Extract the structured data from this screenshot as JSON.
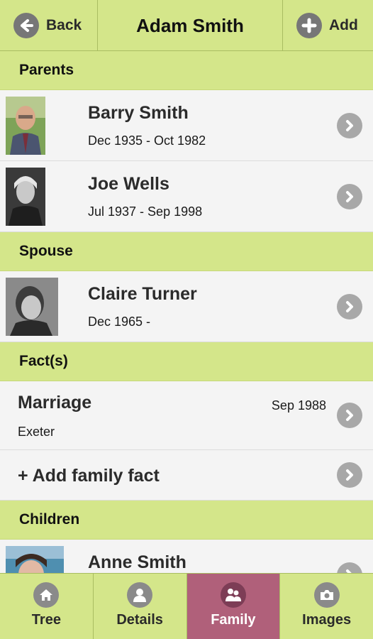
{
  "header": {
    "back_label": "Back",
    "title": "Adam Smith",
    "add_label": "Add"
  },
  "sections": {
    "parents": "Parents",
    "spouse": "Spouse",
    "facts": "Fact(s)",
    "children": "Children"
  },
  "parents": [
    {
      "name": "Barry Smith",
      "dates": "Dec 1935 - Oct 1982"
    },
    {
      "name": "Joe Wells",
      "dates": "Jul 1937 - Sep 1998"
    }
  ],
  "spouse": [
    {
      "name": "Claire Turner",
      "dates": "Dec 1965 -"
    }
  ],
  "facts": [
    {
      "type": "Marriage",
      "date": "Sep 1988",
      "place": "Exeter"
    }
  ],
  "add_fact_label": "+ Add family fact",
  "children": [
    {
      "name": "Anne Smith"
    }
  ],
  "tabs": [
    {
      "label": "Tree",
      "icon": "house-icon"
    },
    {
      "label": "Details",
      "icon": "person-icon"
    },
    {
      "label": "Family",
      "icon": "family-icon",
      "active": true
    },
    {
      "label": "Images",
      "icon": "camera-icon"
    }
  ],
  "colors": {
    "bar_green": "#d4e68a",
    "active_tab": "#b0607a",
    "icon_gray": "#777777"
  }
}
